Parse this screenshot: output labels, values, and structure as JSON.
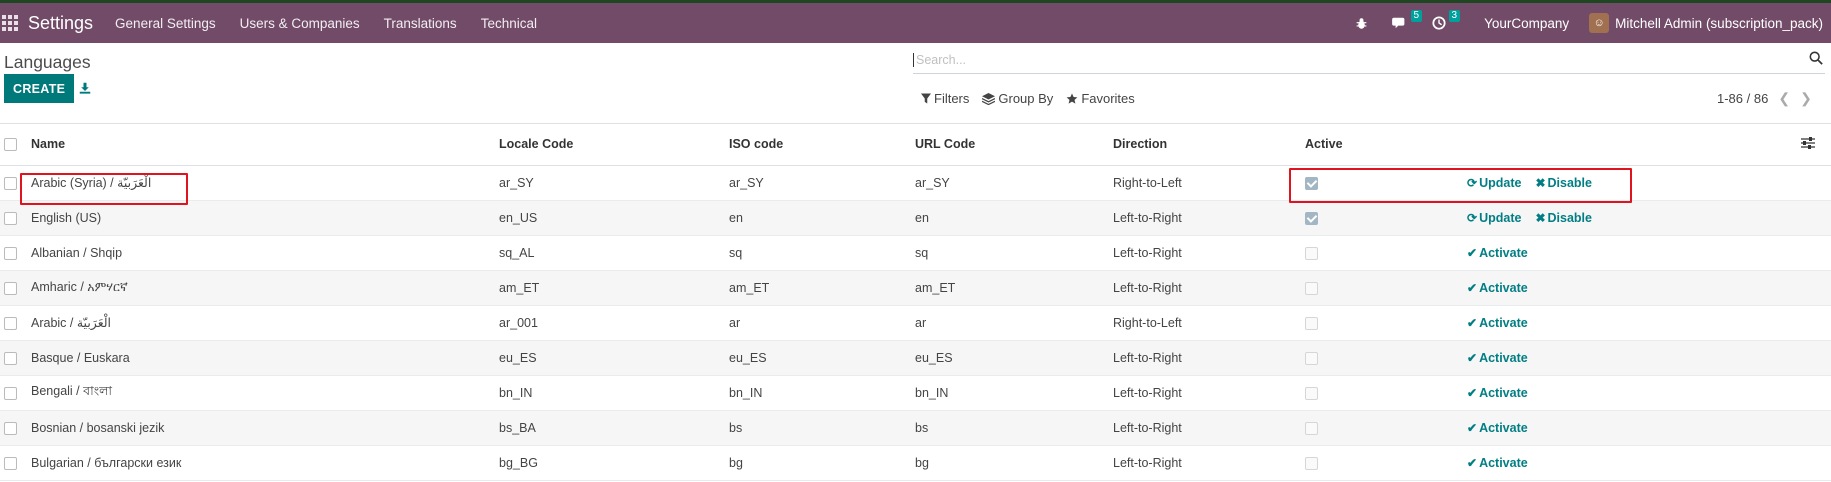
{
  "navbar": {
    "app_name": "Settings",
    "menu": [
      "General Settings",
      "Users & Companies",
      "Translations",
      "Technical"
    ],
    "messages_badge": "5",
    "activities_badge": "3",
    "company": "YourCompany",
    "user": "Mitchell Admin (subscription_pack)"
  },
  "control": {
    "title": "Languages",
    "create_label": "CREATE",
    "search_placeholder": "Search...",
    "filters_label": "Filters",
    "groupby_label": "Group By",
    "favorites_label": "Favorites",
    "pager": "1-86 / 86"
  },
  "table": {
    "headers": [
      "Name",
      "Locale Code",
      "ISO code",
      "URL Code",
      "Direction",
      "Active"
    ],
    "rows": [
      {
        "name": "Arabic (Syria) / الْعَرَبيّة",
        "locale": "ar_SY",
        "iso": "ar_SY",
        "url": "ar_SY",
        "direction": "Right-to-Left",
        "active": true
      },
      {
        "name": "English (US)",
        "locale": "en_US",
        "iso": "en",
        "url": "en",
        "direction": "Left-to-Right",
        "active": true
      },
      {
        "name": "Albanian / Shqip",
        "locale": "sq_AL",
        "iso": "sq",
        "url": "sq",
        "direction": "Left-to-Right",
        "active": false
      },
      {
        "name": "Amharic / አምሃርኛ",
        "locale": "am_ET",
        "iso": "am_ET",
        "url": "am_ET",
        "direction": "Left-to-Right",
        "active": false
      },
      {
        "name": "Arabic / الْعَرَبيّة",
        "locale": "ar_001",
        "iso": "ar",
        "url": "ar",
        "direction": "Right-to-Left",
        "active": false
      },
      {
        "name": "Basque / Euskara",
        "locale": "eu_ES",
        "iso": "eu_ES",
        "url": "eu_ES",
        "direction": "Left-to-Right",
        "active": false
      },
      {
        "name": "Bengali / বাংলা",
        "locale": "bn_IN",
        "iso": "bn_IN",
        "url": "bn_IN",
        "direction": "Left-to-Right",
        "active": false
      },
      {
        "name": "Bosnian / bosanski jezik",
        "locale": "bs_BA",
        "iso": "bs",
        "url": "bs",
        "direction": "Left-to-Right",
        "active": false
      },
      {
        "name": "Bulgarian / български език",
        "locale": "bg_BG",
        "iso": "bg",
        "url": "bg",
        "direction": "Left-to-Right",
        "active": false
      }
    ],
    "update_label": "Update",
    "disable_label": "Disable",
    "activate_label": "Activate"
  },
  "colors": {
    "navbar": "#714b67",
    "accent": "#00797b",
    "highlight": "#e0141e"
  }
}
